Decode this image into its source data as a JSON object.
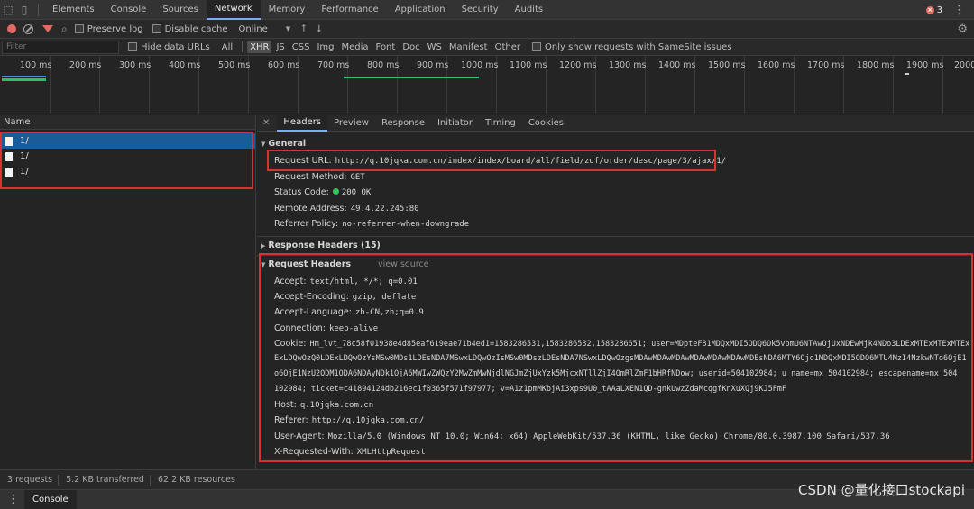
{
  "tabbar": {
    "tabs": [
      "Elements",
      "Console",
      "Sources",
      "Network",
      "Memory",
      "Performance",
      "Application",
      "Security",
      "Audits"
    ],
    "active_tab": "Network",
    "error_count": "3"
  },
  "toolbar": {
    "preserve_log": "Preserve log",
    "disable_cache": "Disable cache",
    "throttling": "Online"
  },
  "filterbar": {
    "filter_placeholder": "Filter",
    "hide_data_urls": "Hide data URLs",
    "types": [
      "All",
      "XHR",
      "JS",
      "CSS",
      "Img",
      "Media",
      "Font",
      "Doc",
      "WS",
      "Manifest",
      "Other"
    ],
    "active_type": "XHR",
    "samesite": "Only show requests with SameSite issues"
  },
  "timeline": {
    "ticks": [
      "100 ms",
      "200 ms",
      "300 ms",
      "400 ms",
      "500 ms",
      "600 ms",
      "700 ms",
      "800 ms",
      "900 ms",
      "1000 ms",
      "1100 ms",
      "1200 ms",
      "1300 ms",
      "1400 ms",
      "1500 ms",
      "1600 ms",
      "1700 ms",
      "1800 ms",
      "1900 ms",
      "2000"
    ]
  },
  "request_list": {
    "header": "Name",
    "rows": [
      "1/",
      "1/",
      "1/"
    ]
  },
  "details": {
    "tabs": [
      "Headers",
      "Preview",
      "Response",
      "Initiator",
      "Timing",
      "Cookies"
    ],
    "active_tab": "Headers",
    "general": {
      "title": "General",
      "request_url_label": "Request URL:",
      "request_url": "http://q.10jqka.com.cn/index/index/board/all/field/zdf/order/desc/page/3/ajax/1/",
      "request_method_label": "Request Method:",
      "request_method": "GET",
      "status_code_label": "Status Code:",
      "status_code": "200 OK",
      "remote_address_label": "Remote Address:",
      "remote_address": "49.4.22.245:80",
      "referrer_policy_label": "Referrer Policy:",
      "referrer_policy": "no-referrer-when-downgrade"
    },
    "response_headers": {
      "title": "Response Headers (15)"
    },
    "request_headers": {
      "title": "Request Headers",
      "view_source": "view source",
      "accept_label": "Accept:",
      "accept": "text/html, */*; q=0.01",
      "accept_encoding_label": "Accept-Encoding:",
      "accept_encoding": "gzip, deflate",
      "accept_language_label": "Accept-Language:",
      "accept_language": "zh-CN,zh;q=0.9",
      "connection_label": "Connection:",
      "connection": "keep-alive",
      "cookie_label": "Cookie:",
      "cookie_lines": [
        "Hm_lvt_78c58f01938e4d85eaf619eae71b4ed1=1583286531,1583286532,1583286651; user=MDpteF81MDQxMDI5ODQ6Ok5vbmU6NTAwOjUxNDEwMjk4NDo3LDExMTExMTExMTExMTExMTExMTExMTEx",
        "ExLDQwOzQ0LDExLDQwOzYsMSw0MDs1LDEsNDA7MSwxLDQwOzIsMSw0MDszLDEsNDA7NSwxLDQwOzgsMDAwMDAwMDAwMDAwMDAwMDAwMDEsNDA6MTY6Ojo1MDQxMDI5ODQ6MTU4MzI4NzkwNTo6OjE1",
        "o6OjE1NzU2ODM1ODA6NDAyNDk1OjA6MWIwZWQzY2MwZmMwNjdlNGJmZjUxYzk5MjcxNTllZjI4OmRlZmF1bHRfNDow; userid=504102984; u_name=mx_504102984; escapename=mx_504",
        "102984; ticket=c41894124db216ec1f0365f571f97977; v=A1z1pmMKbjAi3xps9U0_tAAaLXEN1QD-gnkUwzZdaMcqgfKnXuXQj9KJ5FmF"
      ],
      "host_label": "Host:",
      "host": "q.10jqka.com.cn",
      "referer_label": "Referer:",
      "referer": "http://q.10jqka.com.cn/",
      "user_agent_label": "User-Agent:",
      "user_agent": "Mozilla/5.0 (Windows NT 10.0; Win64; x64) AppleWebKit/537.36 (KHTML, like Gecko) Chrome/80.0.3987.100 Safari/537.36",
      "x_requested_with_label": "X-Requested-With:",
      "x_requested_with": "XMLHttpRequest"
    }
  },
  "statusbar": {
    "requests": "3 requests",
    "transferred": "5.2 KB transferred",
    "resources": "62.2 KB resources"
  },
  "drawer": {
    "console_tab": "Console"
  },
  "watermark": "CSDN @量化接口stockapi",
  "colors": {
    "highlight_box": "#d83232",
    "selected_row": "#1a5b9a",
    "accent": "#7cacf8",
    "record": "#e46962",
    "status_ok": "#35c35a"
  }
}
